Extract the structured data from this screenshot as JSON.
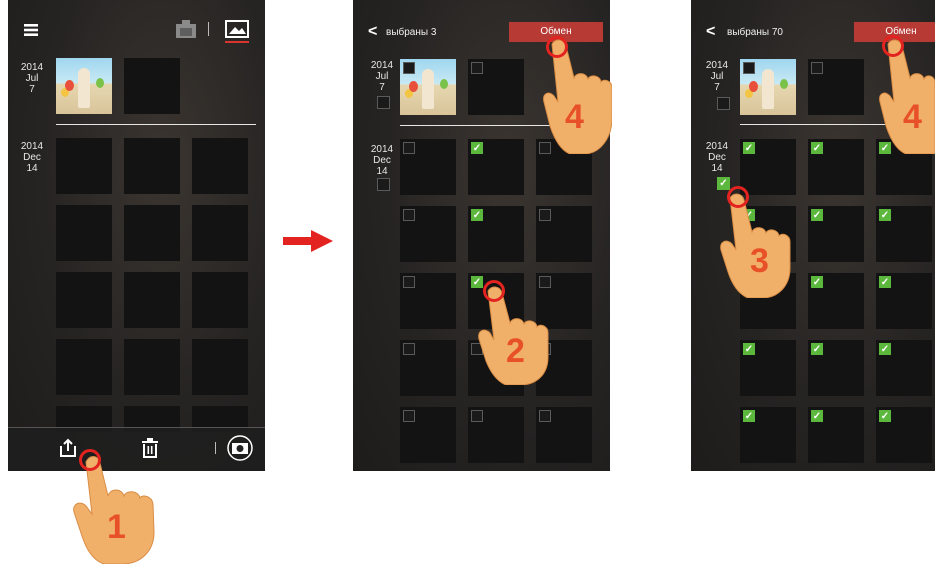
{
  "screen1": {
    "menu_icon": "hamburger-icon",
    "camera_tab_icon": "camera-icon",
    "gallery_tab_icon": "gallery-icon",
    "groups": [
      {
        "year": "2014",
        "month": "Jul",
        "day": "7"
      },
      {
        "year": "2014",
        "month": "Dec",
        "day": "14"
      }
    ],
    "bottom_icons": [
      "share-icon",
      "trash-icon",
      "camera-switch-icon"
    ]
  },
  "screen2": {
    "back_glyph": "<",
    "selected_label": "выбраны 3",
    "share_button": "Обмен",
    "groups": [
      {
        "year": "2014",
        "month": "Jul",
        "day": "7"
      },
      {
        "year": "2014",
        "month": "Dec",
        "day": "14"
      }
    ]
  },
  "screen3": {
    "back_glyph": "<",
    "selected_label": "выбраны 70",
    "share_button": "Обмен",
    "groups": [
      {
        "year": "2014",
        "month": "Jul",
        "day": "7"
      },
      {
        "year": "2014",
        "month": "Dec",
        "day": "14"
      }
    ]
  },
  "steps": {
    "s1": "1",
    "s2": "2",
    "s3": "3",
    "s4a": "4",
    "s4b": "4"
  },
  "colors": {
    "accent_red": "#b73a35",
    "check_green": "#5cb83c",
    "step_orange": "#e8502a"
  }
}
